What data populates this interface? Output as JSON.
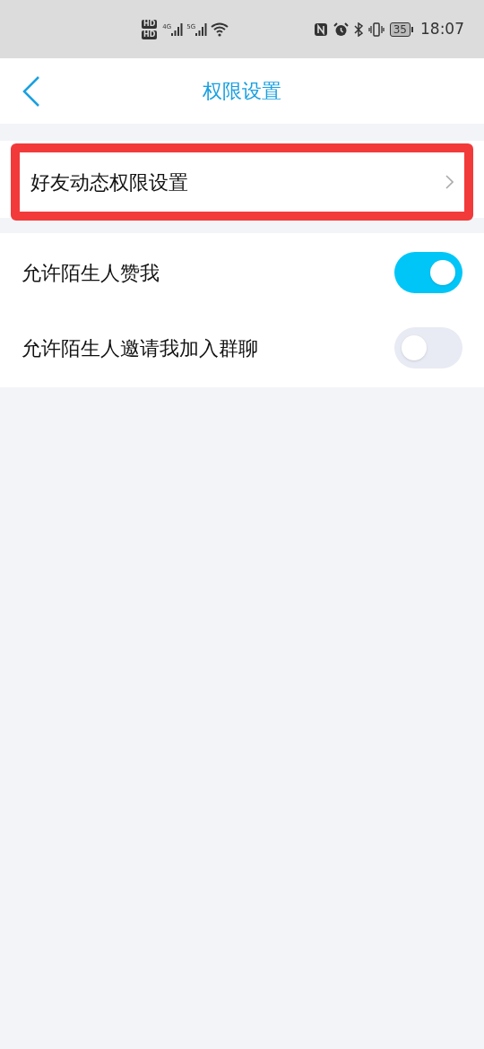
{
  "status_bar": {
    "sim_badges": [
      "HD",
      "HD"
    ],
    "networks": [
      "4G",
      "5G"
    ],
    "battery": "35",
    "time": "18:07"
  },
  "header": {
    "title": "权限设置"
  },
  "link_row": {
    "label": "好友动态权限设置",
    "highlighted": true
  },
  "toggles": [
    {
      "label": "允许陌生人赞我",
      "on": true
    },
    {
      "label": "允许陌生人邀请我加入群聊",
      "on": false
    }
  ]
}
